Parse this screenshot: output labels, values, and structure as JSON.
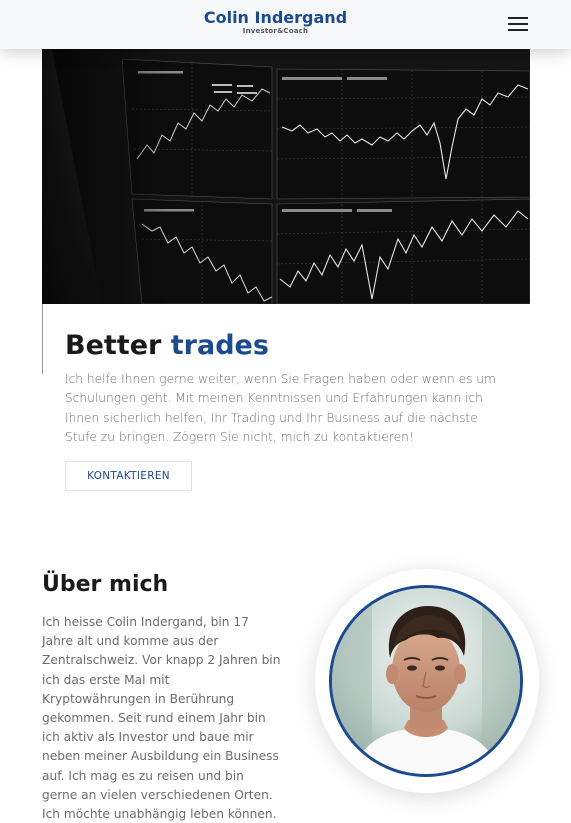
{
  "header": {
    "brand_name": "Colin Indergand",
    "brand_subtitle": "Investor&Coach",
    "menu_icon": "hamburger-menu-icon"
  },
  "hero": {
    "image": "trading-screen-chart-photo",
    "title_part1": "Better",
    "title_part2": "trades",
    "text": "Ich helfe Ihnen gerne weiter, wenn Sie Fragen haben oder wenn es um Schulungen geht. Mit meinen Kenntnissen und Erfahrungen kann ich Ihnen sicherlich helfen, Ihr Trading und Ihr Business auf die nächste Stufe zu bringen. Zögern Sie nicht, mich zu kontaktieren!",
    "button_label": "KONTAKTIEREN"
  },
  "about": {
    "title": "Über mich",
    "text": "Ich heisse Colin Indergand, bin 17 Jahre alt und komme aus der Zentralschweiz. Vor knapp 2 Jahren bin ich das erste Mal mit Kryptowährungen in Berührung gekommen. Seit rund einem Jahr bin ich aktiv als Investor und baue mir neben meiner Ausbildung ein Business auf. Ich mag es zu reisen und bin gerne an vielen verschiedenen Orten. Ich möchte unabhängig leben können. Für mich ist",
    "portrait": "profile-portrait-photo"
  },
  "colors": {
    "accent": "#1c4a8f",
    "text_muted": "#6c6c6c",
    "header_bg": "#f7f8fa"
  }
}
